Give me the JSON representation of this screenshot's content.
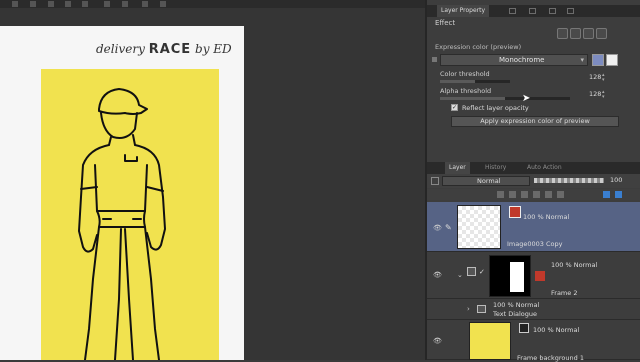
{
  "canvas": {
    "artwork_title_a": "delivery",
    "artwork_title_b": "RACE",
    "artwork_title_c": "by ED"
  },
  "panel": {
    "property_tab": "Layer Property",
    "effect_label": "Effect",
    "expression_color_label": "Expression color (preview)",
    "expression_color_value": "Monochrome",
    "color_threshold_label": "Color threshold",
    "color_threshold_value": "128",
    "color_threshold_level": 0.5,
    "alpha_threshold_label": "Alpha threshold",
    "alpha_threshold_value": "128",
    "alpha_threshold_level": 0.5,
    "reflect_opacity_label": "Reflect layer opacity",
    "reflect_opacity_checked": true,
    "apply_button_label": "Apply expression color of preview"
  },
  "layer_panel": {
    "tabs": [
      "Layer",
      "History",
      "Auto Action"
    ],
    "blend_mode": "Normal",
    "opacity": "100",
    "layers": [
      {
        "mode": "100 % Normal",
        "name": "Image0003 Copy"
      },
      {
        "mode": "100 % Normal",
        "name": "Frame 2"
      },
      {
        "mode": "100 % Normal",
        "name": "Text Dialogue"
      },
      {
        "mode": "100 % Normal",
        "name": "Frame background 1"
      }
    ]
  },
  "colors": {
    "yellow_fill": "#f1e24f",
    "selected_row": "#566385",
    "panel_bg": "#3d3d3d"
  }
}
